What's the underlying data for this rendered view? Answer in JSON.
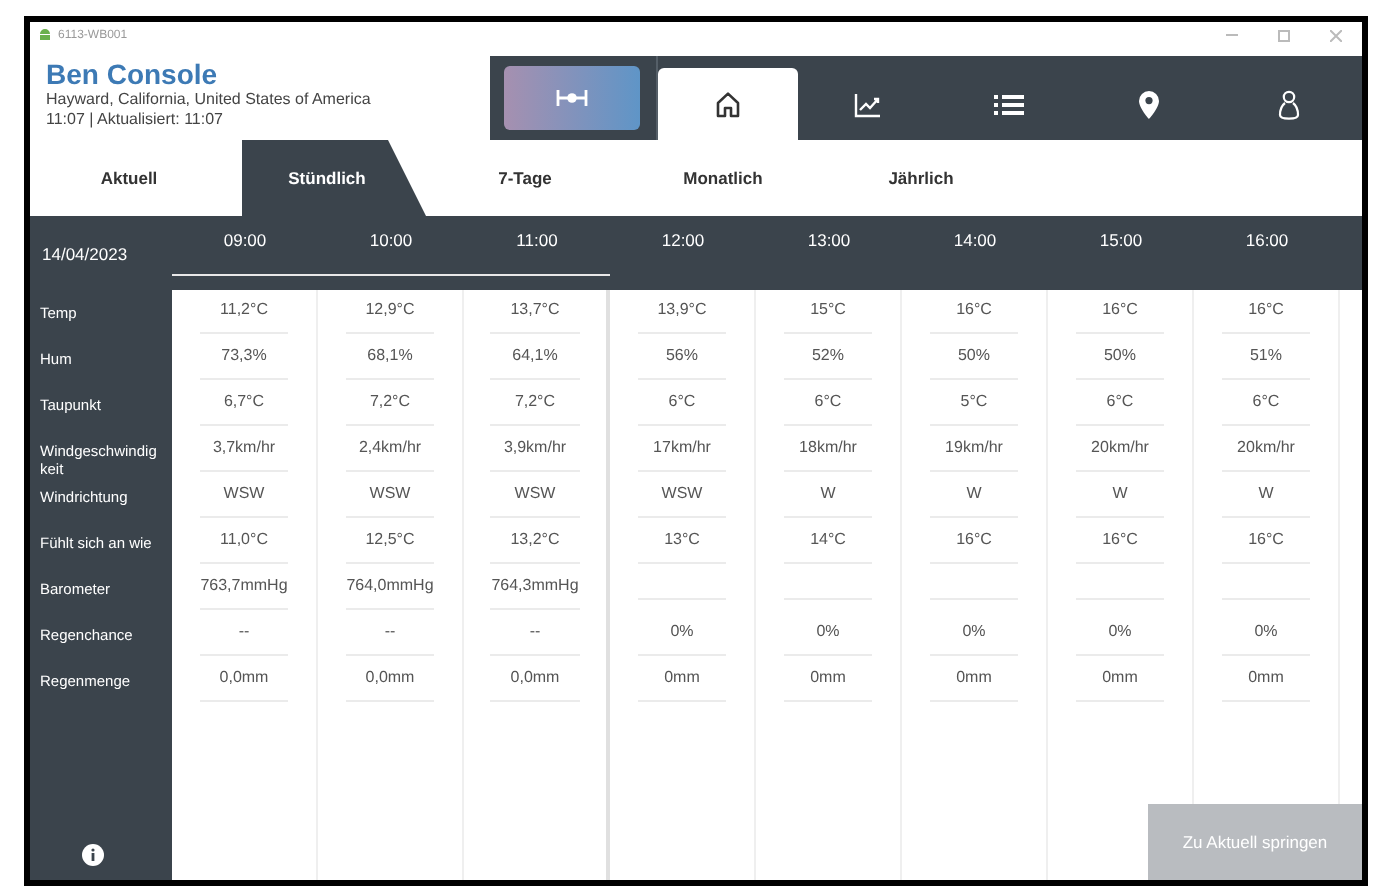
{
  "window": {
    "title": "6113-WB001"
  },
  "header": {
    "station": "Ben Console",
    "location": "Hayward, California, United States of America",
    "time": "11:07 | Aktualisiert: 11:07"
  },
  "nav": [
    {
      "kind": "gauge",
      "selected": false
    },
    {
      "kind": "home",
      "selected": true
    },
    {
      "kind": "chart",
      "selected": false
    },
    {
      "kind": "list",
      "selected": false
    },
    {
      "kind": "pin",
      "selected": false
    },
    {
      "kind": "person",
      "selected": false
    }
  ],
  "tabs": [
    {
      "label": "Aktuell",
      "selected": false
    },
    {
      "label": "Stündlich",
      "selected": true
    },
    {
      "label": "7-Tage",
      "selected": false
    },
    {
      "label": "Monatlich",
      "selected": false
    },
    {
      "label": "Jährlich",
      "selected": false
    }
  ],
  "table": {
    "date": "14/04/2023",
    "columns": [
      {
        "label": "09:00",
        "past": true
      },
      {
        "label": "10:00",
        "past": true
      },
      {
        "label": "11:00",
        "past": true
      },
      {
        "label": "12:00",
        "past": false
      },
      {
        "label": "13:00",
        "past": false
      },
      {
        "label": "14:00",
        "past": false
      },
      {
        "label": "15:00",
        "past": false
      },
      {
        "label": "16:00",
        "past": false
      }
    ],
    "rows": [
      {
        "label": "Temp",
        "cells": [
          "11,2°C",
          "12,9°C",
          "13,7°C",
          "13,9°C",
          "15°C",
          "16°C",
          "16°C",
          "16°C"
        ]
      },
      {
        "label": "Hum",
        "cells": [
          "73,3%",
          "68,1%",
          "64,1%",
          "56%",
          "52%",
          "50%",
          "50%",
          "51%"
        ]
      },
      {
        "label": "Taupunkt",
        "cells": [
          "6,7°C",
          "7,2°C",
          "7,2°C",
          "6°C",
          "6°C",
          "5°C",
          "6°C",
          "6°C"
        ]
      },
      {
        "label": "Windgeschwindigkeit",
        "cells": [
          "3,7km/hr",
          "2,4km/hr",
          "3,9km/hr",
          "17km/hr",
          "18km/hr",
          "19km/hr",
          "20km/hr",
          "20km/hr"
        ]
      },
      {
        "label": "Windrichtung",
        "cells": [
          "WSW",
          "WSW",
          "WSW",
          "WSW",
          "W",
          "W",
          "W",
          "W"
        ]
      },
      {
        "label": "Fühlt sich an wie",
        "cells": [
          "11,0°C",
          "12,5°C",
          "13,2°C",
          "13°C",
          "14°C",
          "16°C",
          "16°C",
          "16°C"
        ]
      },
      {
        "label": "Barometer",
        "cells": [
          "763,7mmHg",
          "764,0mmHg",
          "764,3mmHg"
        ]
      },
      {
        "label": "Regenchance",
        "cells": [
          "--",
          "--",
          "--",
          "0%",
          "0%",
          "0%",
          "0%",
          "0%"
        ]
      },
      {
        "label": "Regenmenge",
        "cells": [
          "0,0mm",
          "0,0mm",
          "0,0mm",
          "0mm",
          "0mm",
          "0mm",
          "0mm",
          "0mm"
        ]
      }
    ]
  },
  "jump_button": "Zu Aktuell springen"
}
